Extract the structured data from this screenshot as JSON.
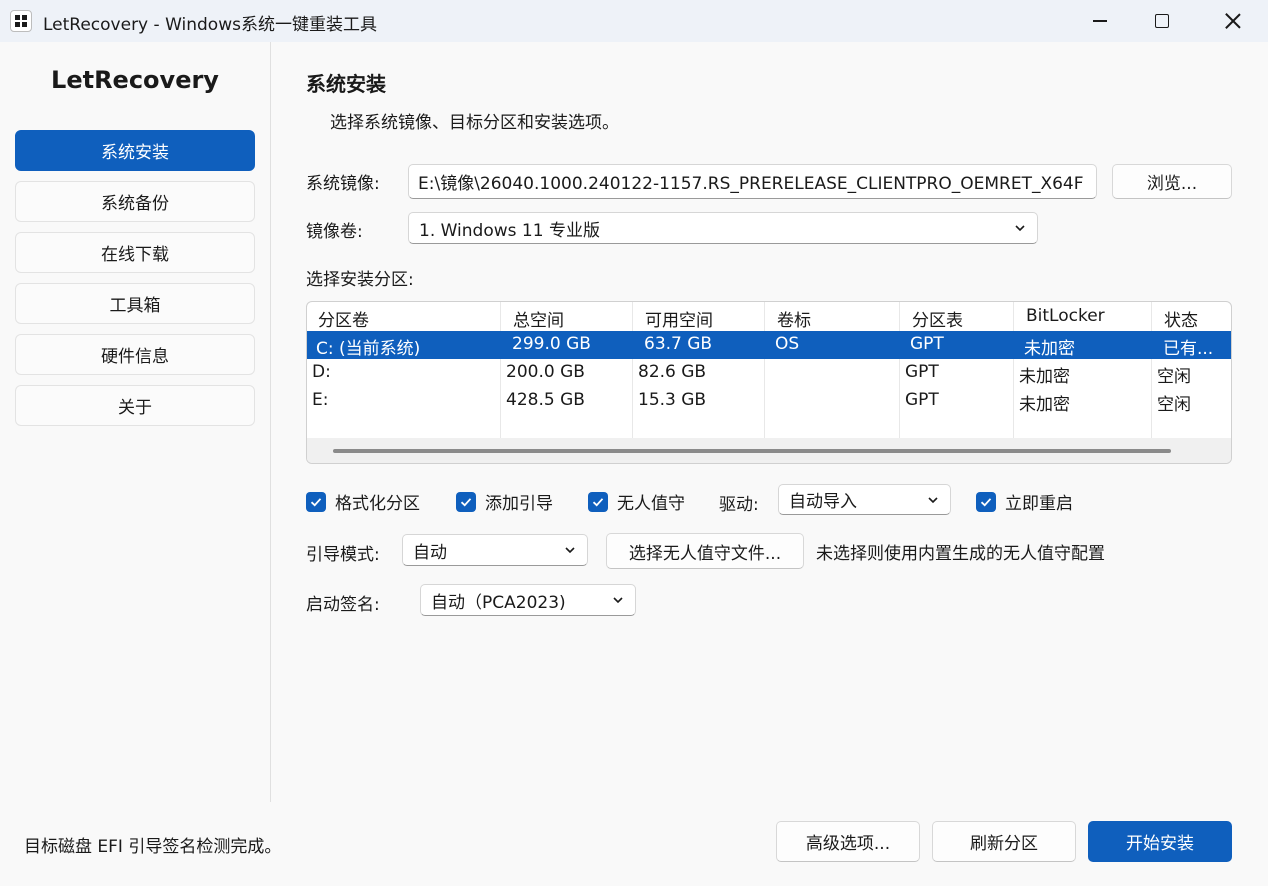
{
  "window": {
    "title": "LetRecovery - Windows系统一键重装工具"
  },
  "sidebar": {
    "title": "LetRecovery",
    "items": [
      {
        "label": "系统安装",
        "active": true
      },
      {
        "label": "系统备份"
      },
      {
        "label": "在线下载"
      },
      {
        "label": "工具箱"
      },
      {
        "label": "硬件信息"
      },
      {
        "label": "关于"
      }
    ]
  },
  "main": {
    "title": "系统安装",
    "description": "选择系统镜像、目标分区和安装选项。",
    "image": {
      "label": "系统镜像:",
      "value": "E:\\镜像\\26040.1000.240122-1157.RS_PRERELEASE_CLIENTPRO_OEMRET_X64F",
      "browse_label": "浏览..."
    },
    "volume": {
      "label": "镜像卷:",
      "selected": "1. Windows 11 专业版"
    },
    "partitions": {
      "label": "选择安装分区:",
      "columns": [
        "分区卷",
        "总空间",
        "可用空间",
        "卷标",
        "分区表",
        "BitLocker",
        "状态"
      ],
      "rows": [
        {
          "volume": "C: (当前系统)",
          "total": "299.0 GB",
          "free": "63.7 GB",
          "label": "OS",
          "table": "GPT",
          "bitlocker": "未加密",
          "status": "已有...",
          "selected": true
        },
        {
          "volume": "D:",
          "total": "200.0 GB",
          "free": "82.6 GB",
          "label": "",
          "table": "GPT",
          "bitlocker": "未加密",
          "status": "空闲"
        },
        {
          "volume": "E:",
          "total": "428.5 GB",
          "free": "15.3 GB",
          "label": "",
          "table": "GPT",
          "bitlocker": "未加密",
          "status": "空闲"
        }
      ]
    },
    "options": {
      "format_label": "格式化分区",
      "format_checked": true,
      "boot_entry_label": "添加引导",
      "boot_entry_checked": true,
      "unattended_label": "无人值守",
      "unattended_checked": true,
      "driver_label": "驱动:",
      "driver_selected": "自动导入",
      "reboot_label": "立即重启",
      "reboot_checked": true
    },
    "boot_mode": {
      "label": "引导模式:",
      "selected": "自动",
      "unattend_file_button": "选择无人值守文件...",
      "unattend_hint": "未选择则使用内置生成的无人值守配置"
    },
    "boot_signature": {
      "label": "启动签名:",
      "selected": "自动（PCA2023)"
    }
  },
  "footer": {
    "status": "目标磁盘 EFI 引导签名检测完成。",
    "advanced_label": "高级选项...",
    "refresh_label": "刷新分区",
    "install_label": "开始安装"
  },
  "colors": {
    "accent": "#0f5fbd",
    "titlebar_bg": "#eef2f8",
    "window_bg": "#f9f9f9"
  }
}
